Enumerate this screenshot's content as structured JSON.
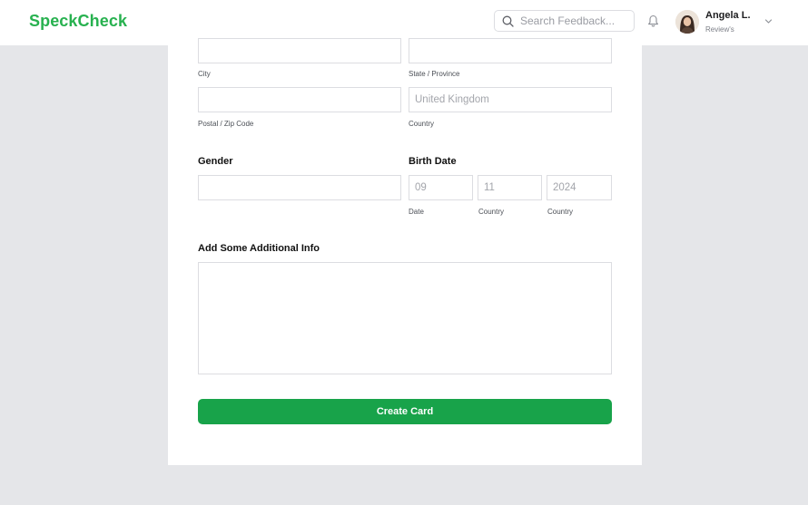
{
  "header": {
    "brand": "SpeckCheck",
    "search_placeholder": "Search Feedback...",
    "user_name": "Angela L.",
    "user_role": "Review's"
  },
  "address": {
    "city_label": "City",
    "state_label": "State / Province",
    "postal_label": "Postal / Zip Code",
    "country_label": "Country",
    "country_placeholder": "United Kingdom"
  },
  "gender": {
    "title": "Gender"
  },
  "birth_date": {
    "title": "Birth Date",
    "day_placeholder": "09",
    "month_placeholder": "11",
    "year_placeholder": "2024",
    "day_label": "Date",
    "month_label": "Country",
    "year_label": "Country"
  },
  "additional_info": {
    "title": "Add Some Additional Info"
  },
  "actions": {
    "create_label": "Create Card"
  },
  "colors": {
    "brand": "#27b14f",
    "primary_button": "#18a34a",
    "background": "#e5e6e9"
  },
  "icons": [
    "search-icon",
    "bell-icon",
    "chevron-down-icon"
  ]
}
